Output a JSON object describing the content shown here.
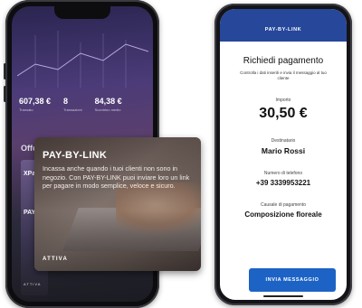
{
  "left_phone": {
    "stats": [
      {
        "value": "607,38 €",
        "label": "Transato"
      },
      {
        "value": "8",
        "label": "Transazioni"
      },
      {
        "value": "84,38 €",
        "label": "Scontrino medio"
      }
    ],
    "offers_title": "Offerte",
    "offer_strip": {
      "line1": "XPa",
      "line2": "PAY",
      "line3": "ATTIVA"
    }
  },
  "popup_card": {
    "title": "PAY-BY-LINK",
    "body": "Incassa anche quando i tuoi clienti non sono in negozio. Con PAY-BY-LINK puoi inviare loro un link per pagare in modo semplice, veloce e sicuro.",
    "action": "ATTIVA"
  },
  "right_phone": {
    "header_brand": "PAY-BY-LINK",
    "title": "Richiedi pagamento",
    "subtitle": "Controlla i dati inseriti e invia il messaggio al tuo cliente",
    "amount_label": "Importo",
    "amount": "30,50 €",
    "recipient_label": "Destinatario",
    "recipient": "Mario Rossi",
    "phone_label": "Numero di telefono",
    "phone": "+39 3339953221",
    "reason_label": "Causale di pagamento",
    "reason": "Composizione floreale",
    "send_button": "INVIA MESSAGGIO"
  },
  "colors": {
    "header_blue": "#26479a",
    "button_blue": "#1d63c5",
    "left_screen_purple": "#4b3b78"
  }
}
